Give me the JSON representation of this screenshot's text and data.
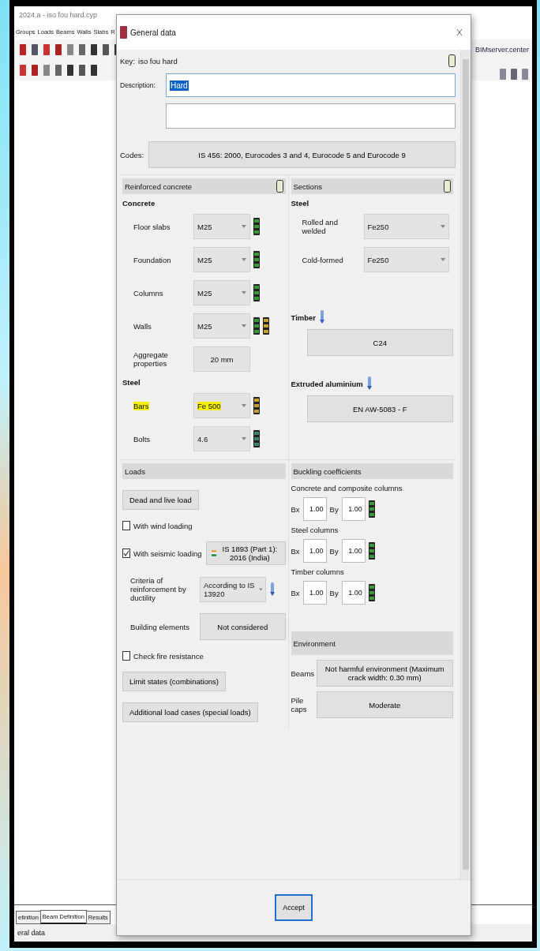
{
  "app": {
    "title": "2024.a - iso fou hard.cyp",
    "menu": [
      "Groups",
      "Loads",
      "Beams",
      "Walls",
      "Slabs",
      "R"
    ],
    "bim_label": "BIMserver.center",
    "tabs": [
      {
        "label": "efinition",
        "selected": false
      },
      {
        "label": "Beam Definition",
        "selected": true
      },
      {
        "label": "Results",
        "selected": false
      }
    ],
    "status_bar": "eral data"
  },
  "dialog": {
    "title": "General data",
    "key_label": "Key:",
    "key": "iso fou hard",
    "description_label": "Description:",
    "description": "Hard",
    "codes_label": "Codes:",
    "codes": "IS 456: 2000, Eurocodes 3 and 4, Eurocode 5 and Eurocode 9",
    "reinforced_concrete": {
      "title": "Reinforced concrete",
      "concrete_title": "Concrete",
      "concrete": [
        {
          "label": "Floor slabs",
          "value": "M25",
          "highlighted": false
        },
        {
          "label": "Foundation",
          "value": "M25",
          "highlighted": false
        },
        {
          "label": "Columns",
          "value": "M25",
          "highlighted": false
        },
        {
          "label": "Walls",
          "value": "M25",
          "highlighted": false
        }
      ],
      "aggregate": {
        "label": "Aggregate properties",
        "value": "20 mm"
      },
      "steel_title": "Steel",
      "steel": [
        {
          "label": "Bars",
          "value": "Fe 500",
          "highlighted": true
        },
        {
          "label": "Bolts",
          "value": "4.6",
          "highlighted": false
        }
      ]
    },
    "sections": {
      "title": "Sections",
      "steel_title": "Steel",
      "steel": [
        {
          "label": "Rolled and welded",
          "value": "Fe250"
        },
        {
          "label": "Cold-formed",
          "value": "Fe250"
        }
      ],
      "timber": {
        "title": "Timber",
        "value": "C24"
      },
      "aluminium": {
        "title": "Extruded aluminium",
        "value": "EN AW-5083 - F"
      }
    },
    "loads": {
      "title": "Loads",
      "items": [
        {
          "kind": "button",
          "label": "Dead and live load"
        },
        {
          "kind": "checkbox",
          "label": "With wind loading",
          "checked": false
        },
        {
          "kind": "checkbox_button",
          "label": "With seismic loading",
          "checked": true,
          "value": "IS 1893 (Part 1): 2016 (India)"
        },
        {
          "kind": "select",
          "label": "Criteria of reinforcement by ductility",
          "value": "According to IS 13920"
        },
        {
          "kind": "label_button",
          "label": "Building elements",
          "value": "Not considered"
        },
        {
          "kind": "checkbox",
          "label": "Check fire resistance",
          "checked": false
        },
        {
          "kind": "button",
          "label": "Limit states (combinations)"
        },
        {
          "kind": "button",
          "label": "Additional load cases (special loads)"
        }
      ]
    },
    "buckling": {
      "title": "Buckling coefficients",
      "groups": [
        {
          "title": "Concrete and composite columns",
          "bx_label": "Bx",
          "bx": "1.00",
          "by_label": "By",
          "by": "1.00"
        },
        {
          "title": "Steel columns",
          "bx_label": "Bx",
          "bx": "1.00",
          "by_label": "By",
          "by": "1.00"
        },
        {
          "title": "Timber columns",
          "bx_label": "Bx",
          "bx": "1.00",
          "by_label": "By",
          "by": "1.00"
        }
      ]
    },
    "environment": {
      "title": "Environment",
      "items": [
        {
          "label": "Beams",
          "value": "Not harmful environment (Maximum crack width: 0.30 mm)"
        },
        {
          "label": "Pile caps",
          "value": "Moderate"
        }
      ]
    },
    "accept": "Accept"
  }
}
